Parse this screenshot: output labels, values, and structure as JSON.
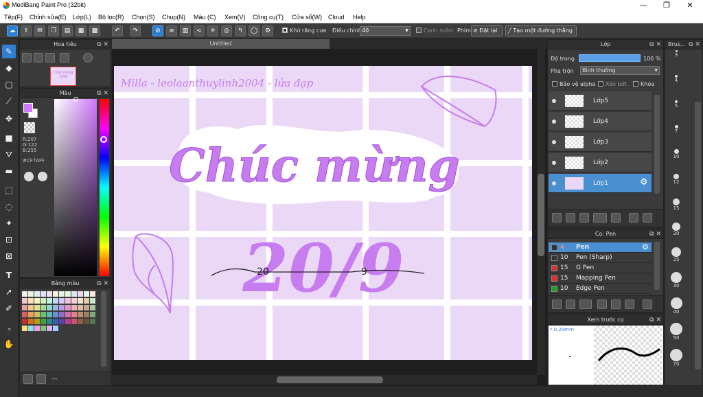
{
  "window": {
    "title": "MediBang Paint Pro (32bit)",
    "minimize": "—",
    "maximize": "❐",
    "close": "✕"
  },
  "menu": [
    "Tệp(F)",
    "Chỉnh sửa(E)",
    "Lớp(L)",
    "Bộ lọc(R)",
    "Chọn(S)",
    "Chụp(N)",
    "Màu (C)",
    "Xem(V)",
    "Công cụ(T)",
    "Cửa sổ(W)",
    "Cloud",
    "Help"
  ],
  "toolbar": {
    "antialias_label": "Khử răng cưa",
    "adjust_label": "Điều chỉnh",
    "adjust_value": "40",
    "edge_label": "Cạnh mềm",
    "key_label": "Phím",
    "reset_label": "Đặt lại",
    "straight_label": "Tạo một đường thẳng"
  },
  "navigator": {
    "title": "Hoa tiêu",
    "thumb_text": "Chúc mừng 20/9"
  },
  "color_panel": {
    "title": "Màu",
    "primary_color": "#CF7AFF",
    "r": "R:207",
    "g": "G:122",
    "b": "B:255",
    "hex": "#CF7AFF"
  },
  "palette": {
    "title": "Bảng màu",
    "footer_text": "---",
    "swatches": [
      "#f4f0e8",
      "#e8f4e0",
      "#dff0f4",
      "#e6e0f4",
      "#f4e0ee",
      "#f8f0d8",
      "#e0f4f0",
      "#eaf4d8",
      "#d8e8f8",
      "#f0d8f0",
      "#e0f8e8",
      "#f8e8e0",
      "#f4c8c8",
      "#f8e0c0",
      "#f8f4c0",
      "#d0f0c0",
      "#c0f0e8",
      "#c0d8f8",
      "#d8c8f0",
      "#f0c0e0",
      "#f8d0d8",
      "#f0e8c8",
      "#e8c8b0",
      "#c8e8d0",
      "#e8a0a0",
      "#f0c890",
      "#e0e098",
      "#a8d890",
      "#90d8c8",
      "#98b8e8",
      "#b8a0e0",
      "#e098c8",
      "#f0b0b8",
      "#d8c0a0",
      "#c8a890",
      "#a8c8a8",
      "#d86060",
      "#e8a060",
      "#c8c060",
      "#70c070",
      "#60b8b0",
      "#6890d8",
      "#9070c8",
      "#d070b0",
      "#e88090",
      "#b89070",
      "#a08068",
      "#80a880",
      "#c03030",
      "#d07020",
      "#b0a020",
      "#40a040",
      "#308888",
      "#3060b8",
      "#6040a0",
      "#b04090",
      "#d05070",
      "#906040",
      "#705040",
      "#507850",
      "#f8e080",
      "#90e0f0",
      "#f0a0e0",
      "#80c080",
      "#e0b0f0",
      "#a0d0ff"
    ]
  },
  "canvas": {
    "doc_title": "Untitled",
    "watermark": "Milla - leolaanthuylinh2004 - lửa đạp",
    "headline": "Chúc mừng",
    "big_text": "20/9",
    "small_left": "20",
    "small_right": "9",
    "bg_color": "#ead8f6",
    "art_color": "#c77cf0"
  },
  "layers_panel": {
    "title": "Lớp",
    "opacity_label": "Độ trong",
    "opacity_value": "100 %",
    "blend_label": "Pha trộn",
    "blend_value": "Bình thường",
    "protect_alpha": "Bảo vệ alpha",
    "clipping": "Xén bớt",
    "lock": "Khóa",
    "layers": [
      "Lớp5",
      "Lớp4",
      "Lớp3",
      "Lớp2",
      "Lớp1"
    ]
  },
  "brush_panel": {
    "title": "Cọ: Pen",
    "brushes": [
      {
        "size": "4",
        "name": "Pen",
        "color": "#333333"
      },
      {
        "size": "10",
        "name": "Pen (Sharp)",
        "color": "#333333"
      },
      {
        "size": "15",
        "name": "G Pen",
        "color": "#e03030"
      },
      {
        "size": "15",
        "name": "Mapping Pen",
        "color": "#e03030"
      },
      {
        "size": "10",
        "name": "Edge Pen",
        "color": "#20a020"
      }
    ]
  },
  "preview_panel": {
    "title": "Xem trước cọ",
    "size_text": "* 0.29mm"
  },
  "brush_size_panel": {
    "title": "Brus...",
    "sizes": [
      "3",
      "4",
      "5",
      "7",
      "10",
      "12",
      "15",
      "20",
      "25",
      "30",
      "40",
      "50",
      "70"
    ]
  },
  "colors": {
    "accent": "#2f7fd0",
    "selected_layer": "#4a90d0"
  }
}
